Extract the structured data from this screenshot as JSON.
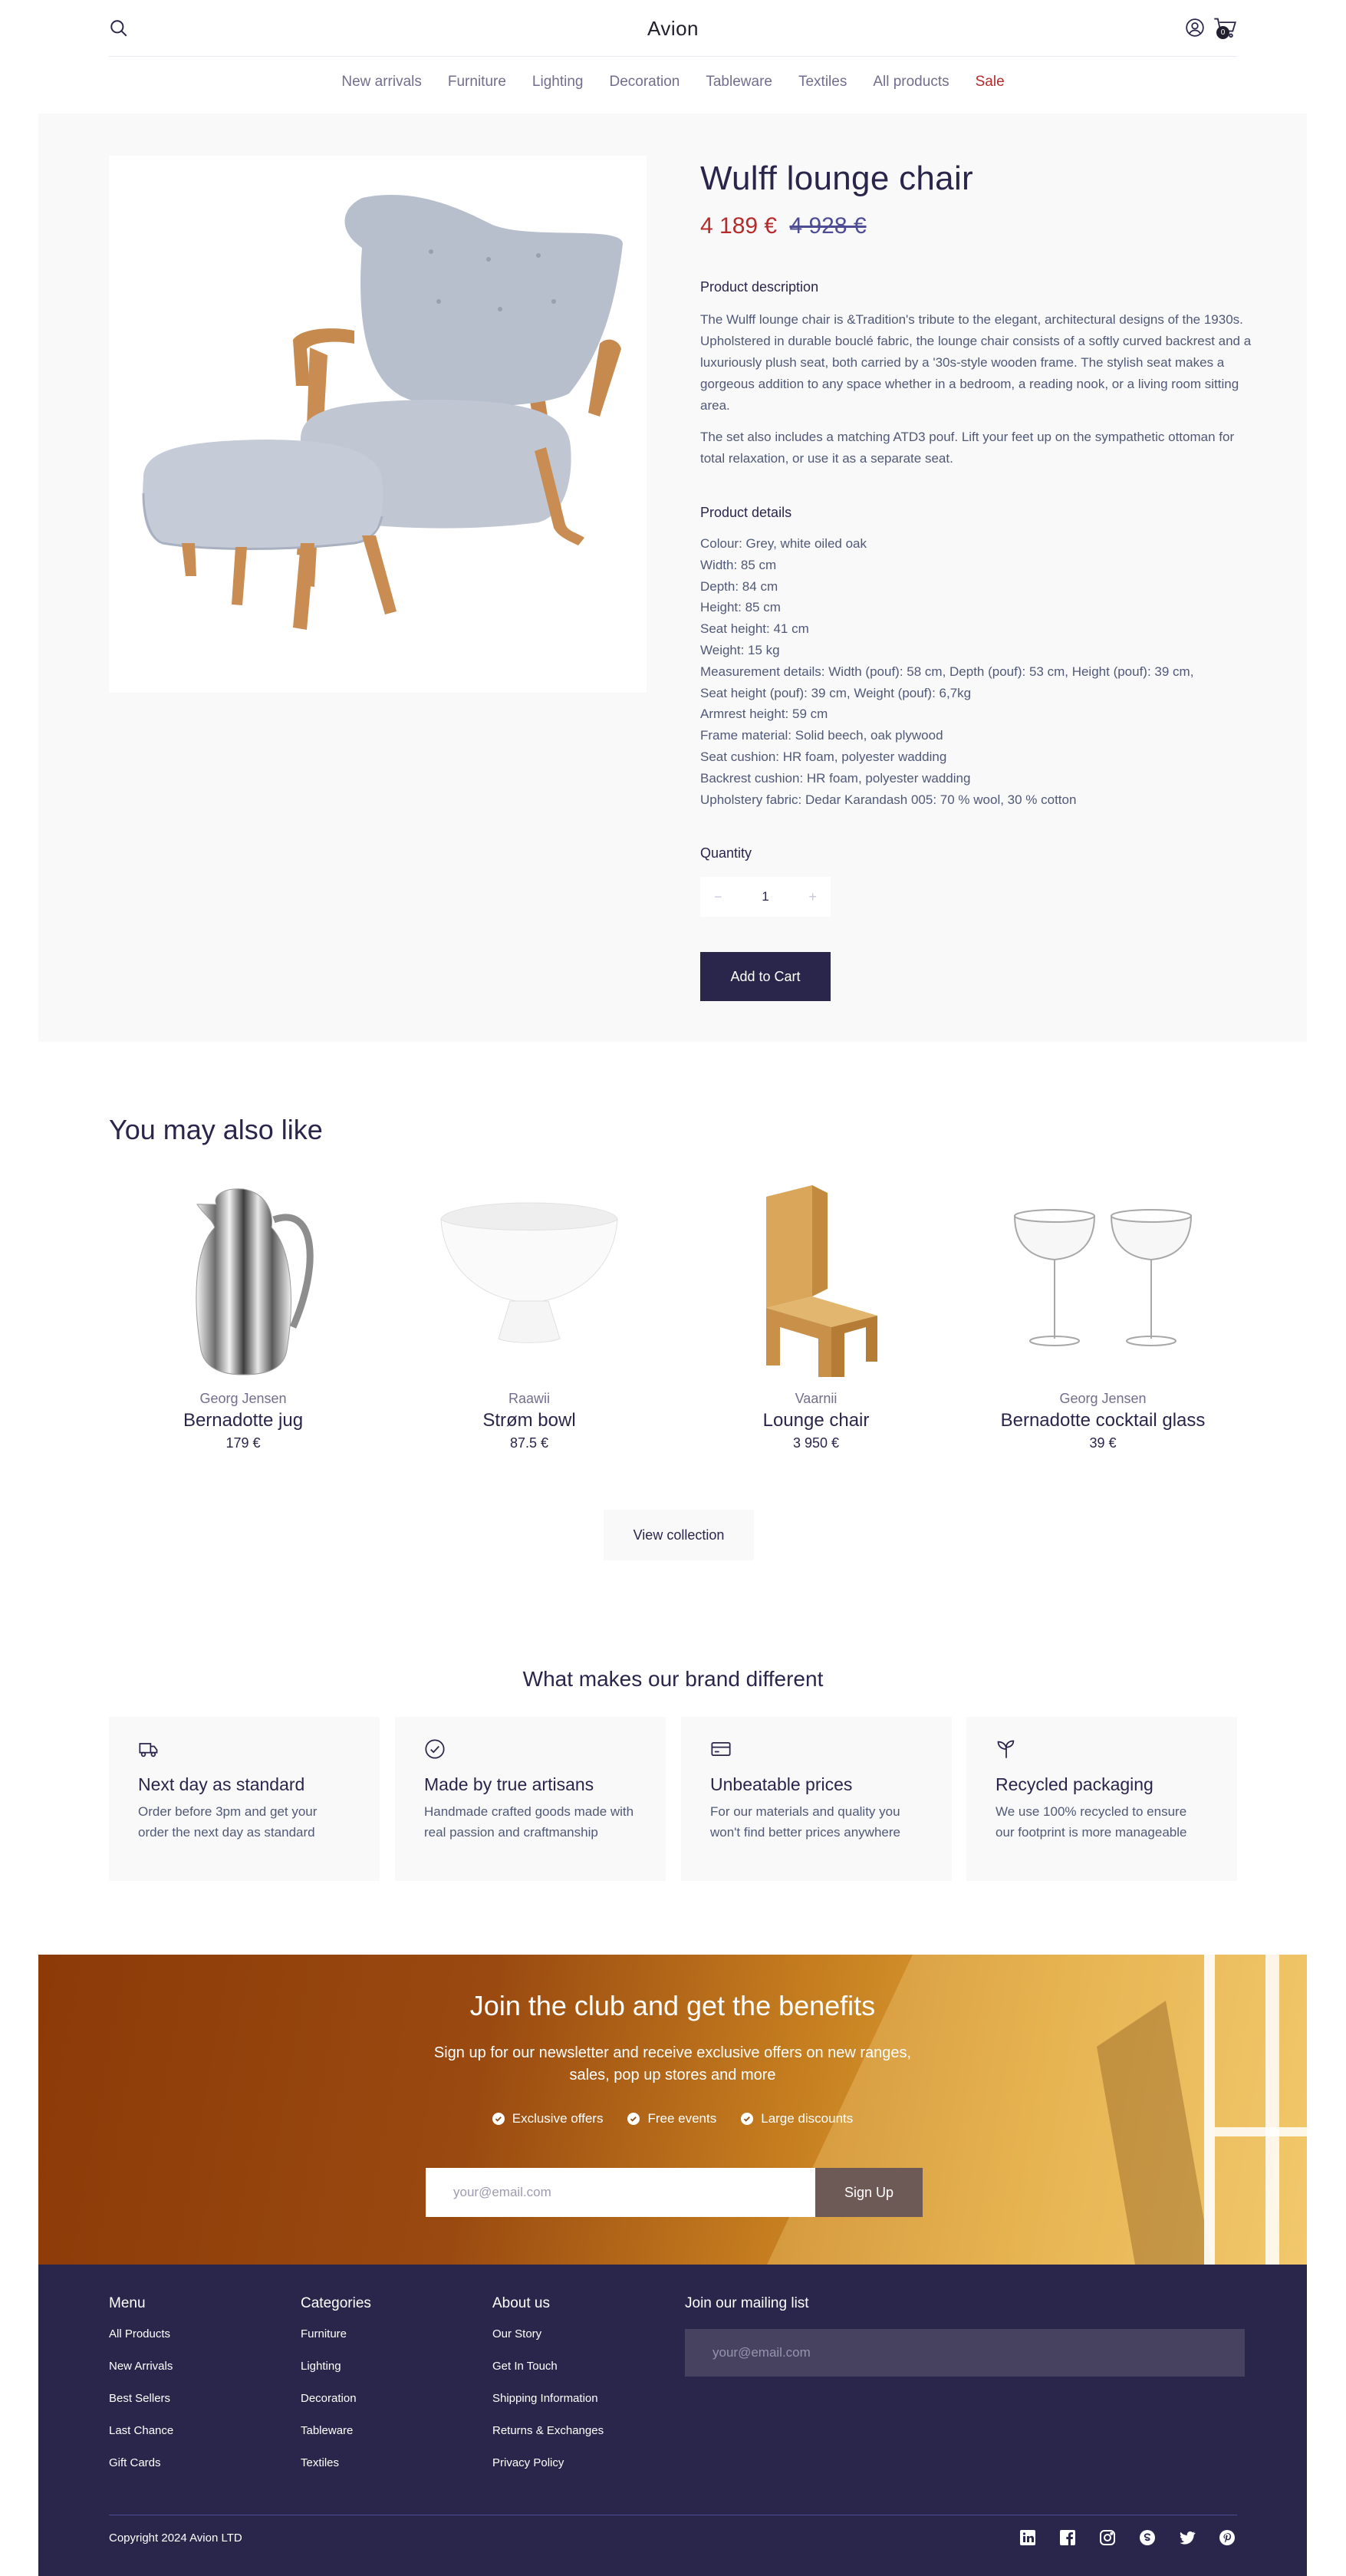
{
  "header": {
    "logo": "Avion",
    "cart_count": "0"
  },
  "nav": {
    "items": [
      "New arrivals",
      "Furniture",
      "Lighting",
      "Decoration",
      "Tableware",
      "Textiles",
      "All products"
    ],
    "sale": "Sale"
  },
  "product": {
    "title": "Wulff lounge chair",
    "price": "4 189 €",
    "old_price": "4 928 €",
    "description_label": "Product description",
    "description": [
      "The Wulff lounge chair is &Tradition's tribute to the elegant, architectural designs of the 1930s. Upholstered in durable bouclé fabric, the lounge chair consists of a softly curved backrest and a luxuriously plush seat, both carried by a '30s-style wooden frame. The stylish seat makes a gorgeous addition to any space whether in a bedroom, a reading nook, or a living room sitting area.",
      "The set also includes a matching ATD3 pouf. Lift your feet up on the sympathetic ottoman for total relaxation, or use it as a separate seat."
    ],
    "details_label": "Product details",
    "details": [
      "Colour: Grey, white oiled oak",
      "Width: 85 cm",
      "Depth: 84 cm",
      "Height: 85 cm",
      "Seat height: 41 cm",
      "Weight: 15 kg",
      "Measurement details: Width (pouf): 58 cm, Depth (pouf): 53 cm, Height (pouf): 39 cm,",
      "Seat height (pouf): 39 cm, Weight (pouf): 6,7kg",
      "Armrest height: 59 cm",
      "Frame material: Solid beech, oak plywood",
      "Seat cushion: HR foam, polyester wadding",
      "Backrest cushion: HR foam, polyester wadding",
      "Upholstery fabric: Dedar Karandash 005: 70 % wool, 30 % cotton"
    ],
    "quantity_label": "Quantity",
    "quantity": "1",
    "minus": "−",
    "plus": "+",
    "add_to_cart": "Add to Cart"
  },
  "related": {
    "title": "You may also like",
    "items": [
      {
        "brand": "Georg Jensen",
        "name": "Bernadotte jug",
        "price": "179 €"
      },
      {
        "brand": "Raawii",
        "name": "Strøm bowl",
        "price": "87.5 €"
      },
      {
        "brand": "Vaarnii",
        "name": "Lounge chair",
        "price": "3 950 €"
      },
      {
        "brand": "Georg Jensen",
        "name": "Bernadotte cocktail glass",
        "price": "39 €"
      }
    ],
    "view_collection": "View collection"
  },
  "brand": {
    "title": "What makes our brand different",
    "features": [
      {
        "icon": "delivery-truck-icon",
        "title": "Next day as standard",
        "desc": "Order before 3pm and get your order the next day as standard"
      },
      {
        "icon": "check-circle-icon",
        "title": "Made by true artisans",
        "desc": "Handmade crafted goods made with real passion and craftmanship"
      },
      {
        "icon": "credit-card-icon",
        "title": "Unbeatable prices",
        "desc": "For our materials and quality you won't find better prices anywhere"
      },
      {
        "icon": "sprout-icon",
        "title": "Recycled packaging",
        "desc": "We use 100% recycled to ensure our footprint is more manageable"
      }
    ]
  },
  "club": {
    "title": "Join the club and get the benefits",
    "subtitle_1": "Sign up for our newsletter and receive exclusive offers on new ranges,",
    "subtitle_2": "sales, pop up stores and more",
    "perks": [
      "Exclusive offers",
      "Free events",
      "Large discounts"
    ],
    "email_placeholder": "your@email.com",
    "signup": "Sign Up"
  },
  "footer": {
    "menu_title": "Menu",
    "menu": [
      "All Products",
      "New Arrivals",
      "Best Sellers",
      "Last Chance",
      "Gift Cards"
    ],
    "categories_title": "Categories",
    "categories": [
      "Furniture",
      "Lighting",
      "Decoration",
      "Tableware",
      "Textiles"
    ],
    "about_title": "About us",
    "about": [
      "Our Story",
      "Get In Touch",
      "Shipping Information",
      "Returns & Exchanges",
      "Privacy Policy"
    ],
    "mailing_title": "Join our mailing list",
    "mailing_placeholder": "your@email.com",
    "copyright": "Copyright 2024 Avion LTD",
    "social": [
      "linkedin-icon",
      "facebook-icon",
      "instagram-icon",
      "skype-icon",
      "twitter-icon",
      "pinterest-icon"
    ]
  },
  "colors": {
    "brand_dark": "#2a254b",
    "sale_red": "#b52b2b",
    "light_bg": "#f9f9f9"
  }
}
